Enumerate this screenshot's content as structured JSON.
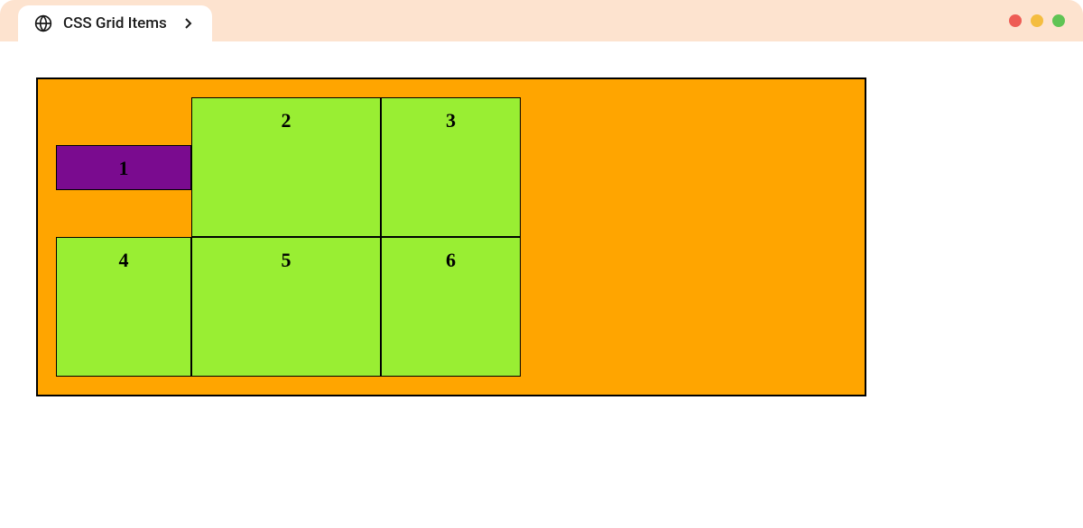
{
  "tab": {
    "title": "CSS Grid Items"
  },
  "traffic_lights": {
    "red": "#ee5c54",
    "yellow": "#f4bd40",
    "green": "#5fc454"
  },
  "grid": {
    "container_bg": "orange",
    "item_bg": "#99ee33",
    "special_item_bg": "#7a0b8f",
    "items": {
      "1": "1",
      "2": "2",
      "3": "3",
      "4": "4",
      "5": "5",
      "6": "6"
    }
  }
}
